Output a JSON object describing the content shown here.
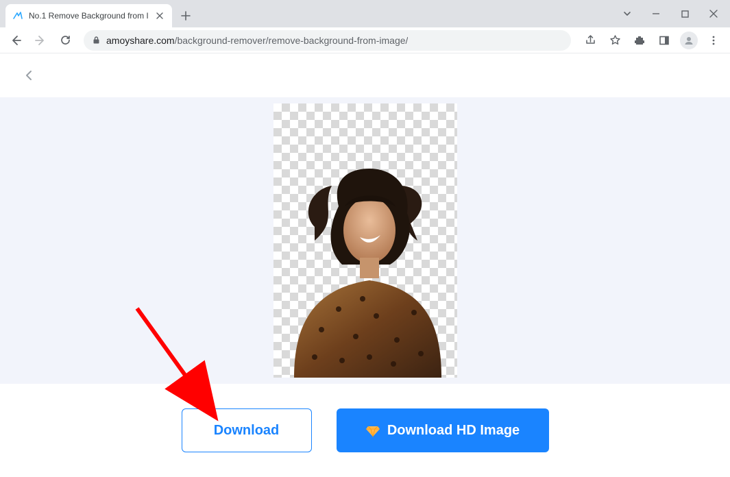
{
  "browser": {
    "tab_title": "No.1 Remove Background from I",
    "url_domain": "amoyshare.com",
    "url_path": "/background-remover/remove-background-from-image/"
  },
  "actions": {
    "download_label": "Download",
    "download_hd_label": "Download HD Image"
  }
}
